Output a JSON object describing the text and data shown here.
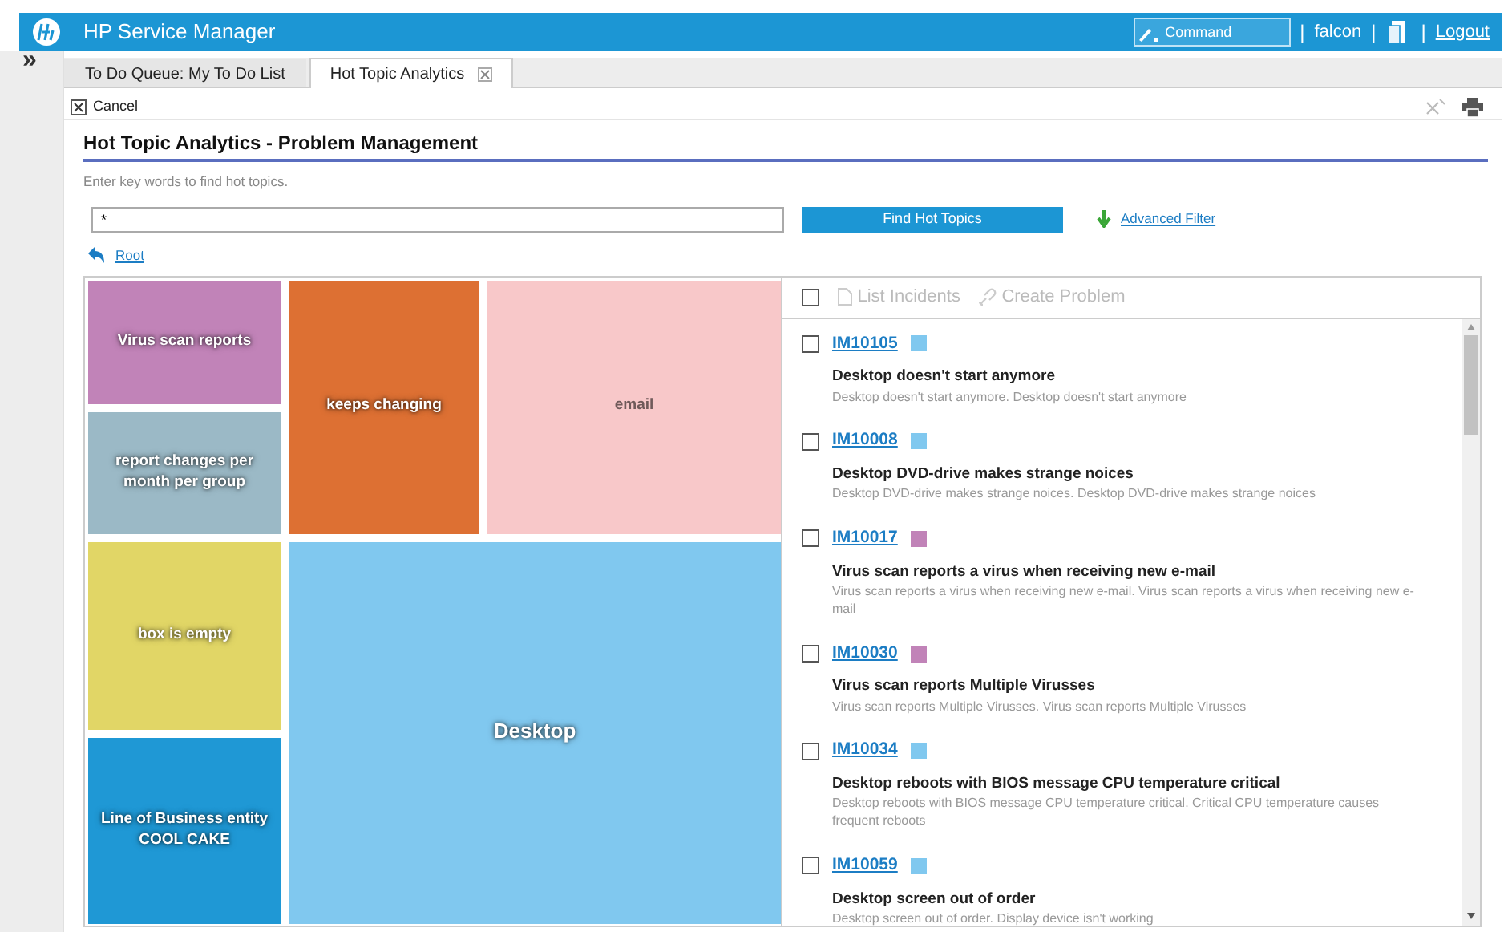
{
  "header": {
    "title": "HP Service Manager",
    "command_placeholder": "Command",
    "user": "falcon",
    "logout": "Logout",
    "separators": [
      "|",
      "|",
      "|"
    ]
  },
  "sidebar": {
    "toggle": "»"
  },
  "tabs": [
    {
      "label": "To Do Queue: My To Do List",
      "selected": false,
      "closable": false
    },
    {
      "label": "Hot Topic Analytics",
      "selected": true,
      "closable": true
    }
  ],
  "toolbar": {
    "cancel": "Cancel"
  },
  "page": {
    "title": "Hot Topic Analytics - Problem Management",
    "hint": "Enter key words to find hot topics.",
    "search_value": "*",
    "find_button": "Find Hot Topics",
    "advanced_filter": "Advanced Filter",
    "root_link": "Root"
  },
  "treemap": [
    {
      "label": "Virus scan reports",
      "color": "#c183b8",
      "kind": "small"
    },
    {
      "label": "keeps changing",
      "color": "#dd7033",
      "kind": "tall"
    },
    {
      "label": "email",
      "color": "#f8c8c9",
      "kind": "tall"
    },
    {
      "label": "report changes per month per group",
      "color": "#9bb9c6",
      "kind": "small"
    },
    {
      "label": "box is empty",
      "color": "#e1d666",
      "kind": "small"
    },
    {
      "label": "Desktop",
      "color": "#80c8ef",
      "kind": "large"
    },
    {
      "label": "Line of Business entity COOL CAKE",
      "color": "#1f98d5",
      "kind": "small"
    }
  ],
  "list_toolbar": {
    "select_all_checked": false,
    "list_incidents": "List Incidents",
    "create_problem": "Create Problem"
  },
  "incidents": [
    {
      "id": "IM10105",
      "color": "#80c8ef",
      "checked": false,
      "title": "Desktop doesn't start anymore",
      "description": "Desktop doesn't start anymore. Desktop doesn't start anymore"
    },
    {
      "id": "IM10008",
      "color": "#80c8ef",
      "checked": false,
      "title": "Desktop DVD-drive makes strange noices",
      "description": "Desktop DVD-drive makes strange noices. Desktop DVD-drive makes strange noices"
    },
    {
      "id": "IM10017",
      "color": "#c183b8",
      "checked": false,
      "title": "Virus scan reports a virus when receiving new e-mail",
      "description": "Virus scan reports a virus when receiving new e-mail. Virus scan reports a virus when receiving new e-mail"
    },
    {
      "id": "IM10030",
      "color": "#c183b8",
      "checked": false,
      "title": "Virus scan reports Multiple Virusses",
      "description": "Virus scan reports Multiple Virusses. Virus scan reports Multiple Virusses"
    },
    {
      "id": "IM10034",
      "color": "#80c8ef",
      "checked": false,
      "title": "Desktop reboots with BIOS message CPU temperature critical",
      "description": "Desktop reboots with BIOS message CPU temperature critical. Critical CPU temperature causes frequent reboots"
    },
    {
      "id": "IM10059",
      "color": "#80c8ef",
      "checked": false,
      "title": "Desktop screen out of order",
      "description": "Desktop screen out of order. Display device isn't working"
    }
  ]
}
